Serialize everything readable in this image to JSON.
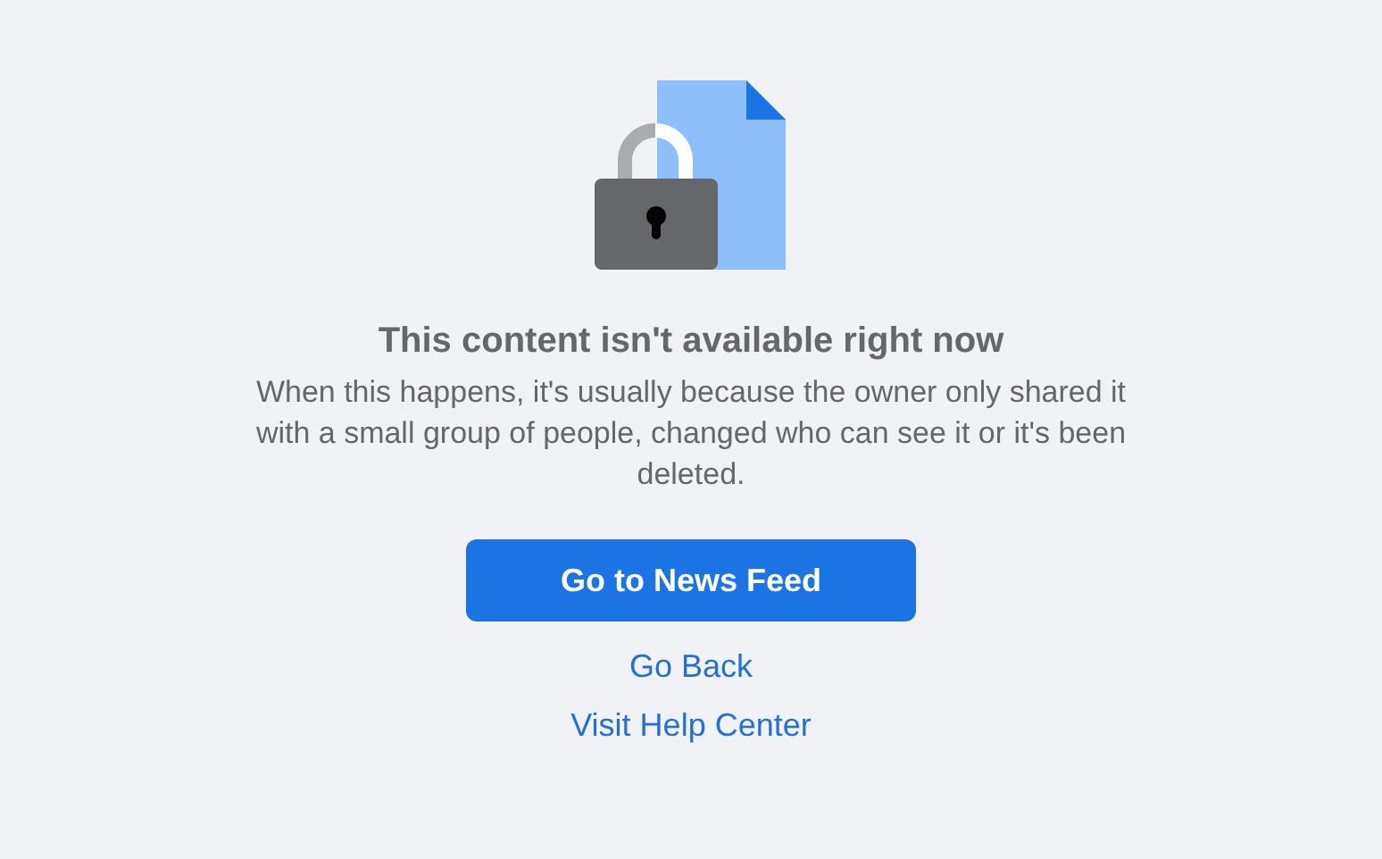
{
  "title": "This content isn't available right now",
  "message": "When this happens, it's usually because the owner only shared it with a small group of people, changed who can see it or it's been deleted.",
  "primary_button": "Go to News Feed",
  "links": [
    "Go Back",
    "Visit Help Center"
  ]
}
